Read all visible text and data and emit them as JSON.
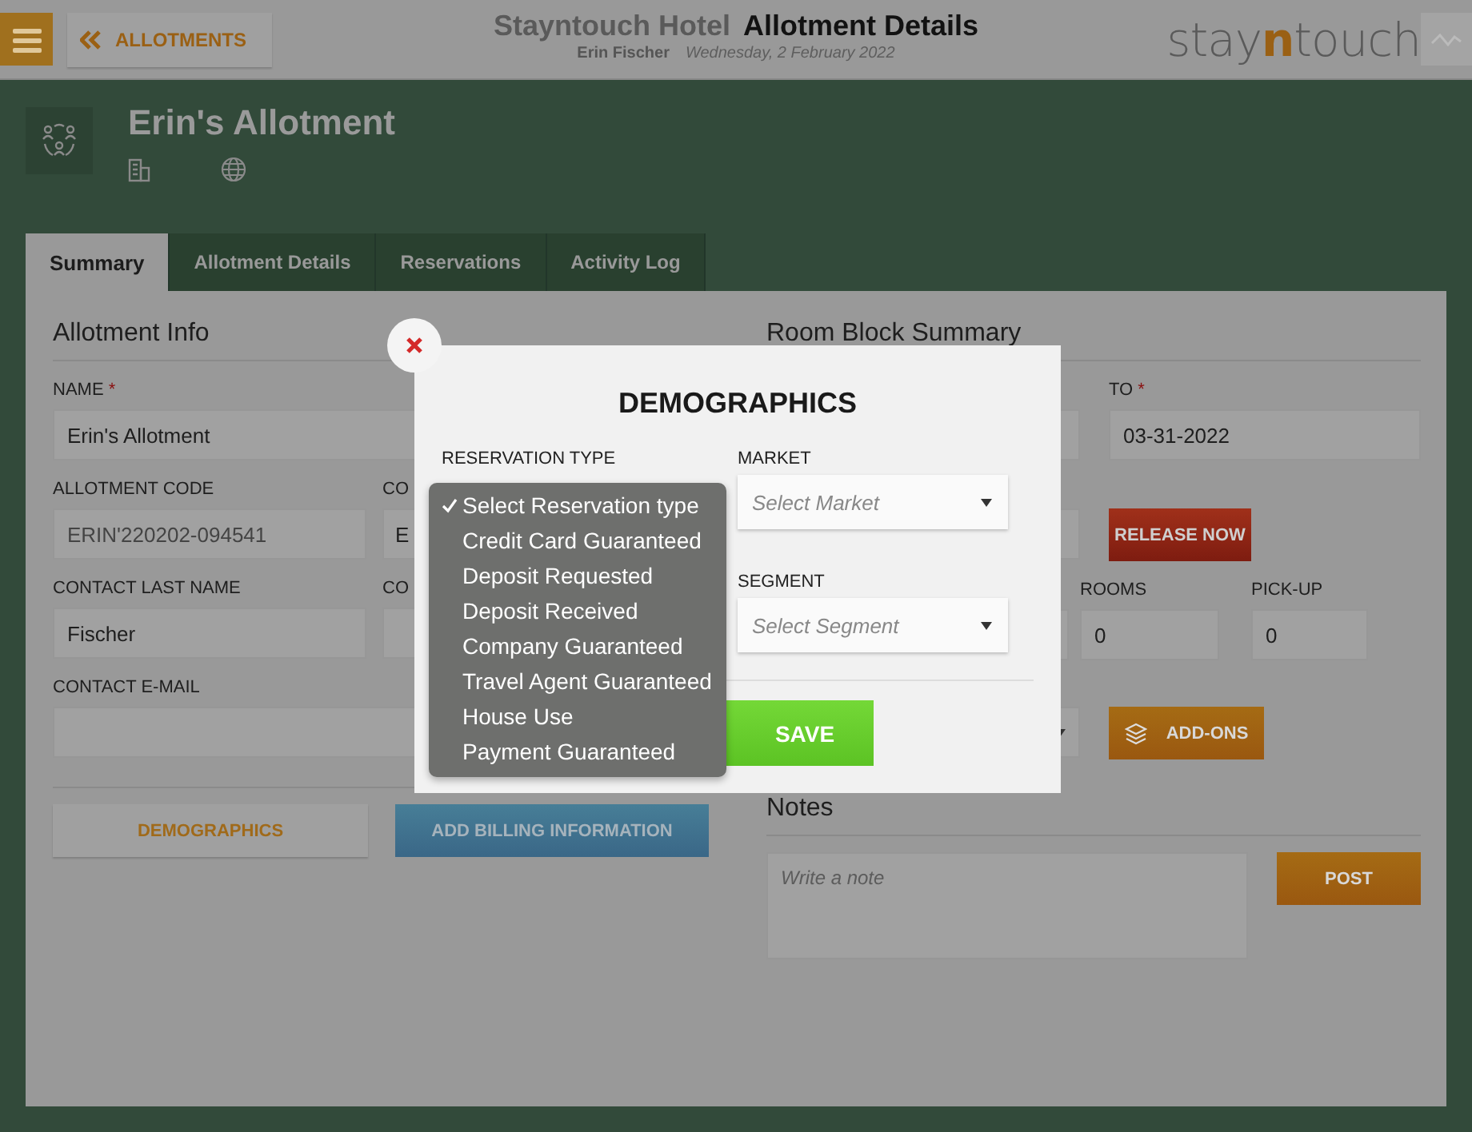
{
  "header": {
    "back_button": {
      "label": "ALLOTMENTS"
    },
    "hotel": "Stayntouch Hotel",
    "page_title": "Allotment Details",
    "user": "Erin Fischer",
    "date": "Wednesday, 2 February 2022",
    "logo": [
      {
        "text": "stay",
        "accent": false
      },
      {
        "text": "n",
        "accent": true
      },
      {
        "text": "touch",
        "accent": false
      }
    ]
  },
  "allotment": {
    "title": "Erin's Allotment"
  },
  "tabs": [
    {
      "label": "Summary",
      "selected": true
    },
    {
      "label": "Allotment Details",
      "selected": false
    },
    {
      "label": "Reservations",
      "selected": false
    },
    {
      "label": "Activity Log",
      "selected": false
    }
  ],
  "allotment_info": {
    "heading": "Allotment Info",
    "name": {
      "label": "NAME",
      "required_mark": "*",
      "value": "Erin's Allotment"
    },
    "code": {
      "label": "ALLOTMENT CODE",
      "value": "ERIN'220202-094541",
      "disabled": true
    },
    "column_2a": {
      "label": "CO",
      "value": "E"
    },
    "contact_last_name": {
      "label": "CONTACT LAST NAME",
      "value": "Fischer"
    },
    "column_2b": {
      "label": "CO"
    },
    "contact_email": {
      "label": "CONTACT E-MAIL"
    },
    "demographics_button": "DEMOGRAPHICS",
    "billing_button": "ADD BILLING INFORMATION"
  },
  "room_block": {
    "heading": "Room Block Summary",
    "to": {
      "label": "TO",
      "required_mark": "*",
      "value": "03-31-2022"
    },
    "release_button": "RELEASE NOW",
    "rooms": {
      "label": "ROOMS",
      "value": "0"
    },
    "pickup": {
      "label": "PICK-UP",
      "value": "0"
    },
    "addons_button": "ADD-ONS"
  },
  "notes": {
    "heading": "Notes",
    "placeholder": "Write a note",
    "post_button": "POST"
  },
  "modal": {
    "title": "DEMOGRAPHICS",
    "reservation_type": {
      "label": "RESERVATION TYPE",
      "options": [
        {
          "label": "Select Reservation type",
          "selected": true
        },
        {
          "label": "Credit Card Guaranteed",
          "selected": false
        },
        {
          "label": "Deposit Requested",
          "selected": false
        },
        {
          "label": "Deposit Received",
          "selected": false
        },
        {
          "label": "Company Guaranteed",
          "selected": false
        },
        {
          "label": "Travel Agent Guaranteed",
          "selected": false
        },
        {
          "label": "House Use",
          "selected": false
        },
        {
          "label": "Payment Guaranteed",
          "selected": false
        }
      ]
    },
    "market": {
      "label": "MARKET",
      "placeholder": "Select Market"
    },
    "segment": {
      "label": "SEGMENT",
      "placeholder": "Select Segment"
    },
    "save_button": "SAVE"
  }
}
